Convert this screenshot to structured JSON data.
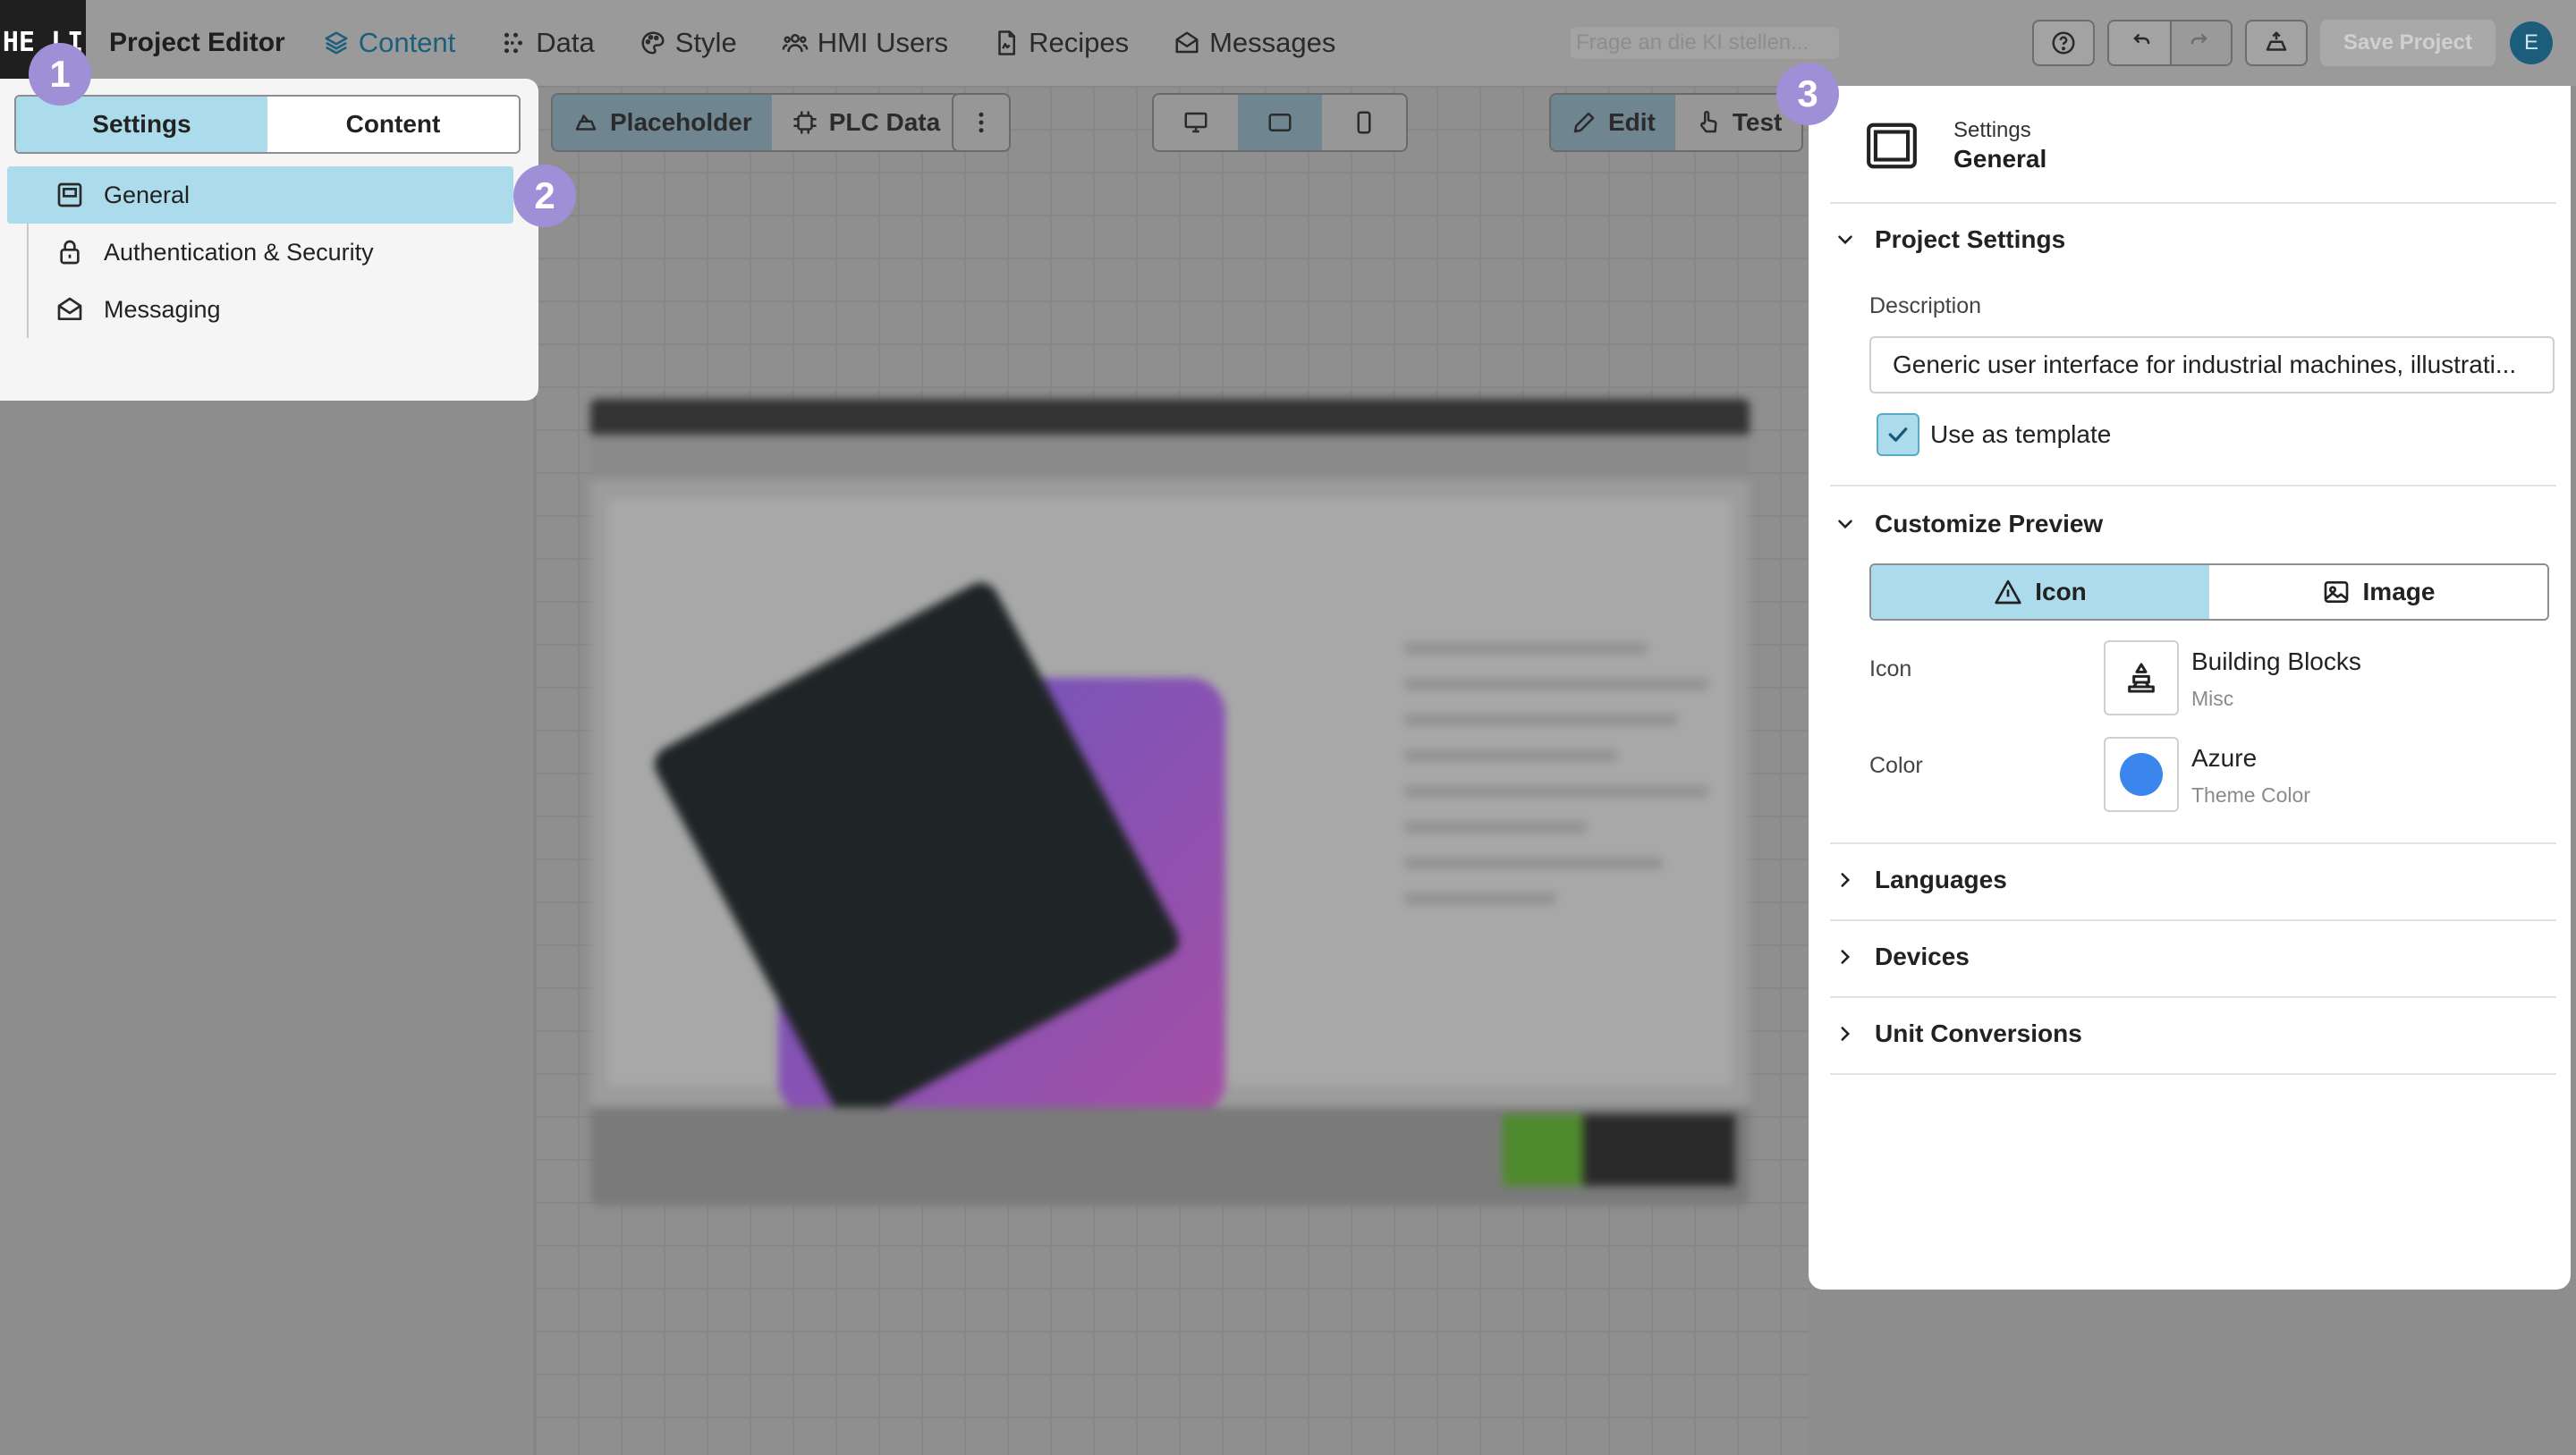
{
  "app": {
    "logo_text": "HE LI",
    "title": "Project Editor"
  },
  "nav": [
    {
      "label": "Content",
      "icon": "layers-icon",
      "active": true
    },
    {
      "label": "Data",
      "icon": "data-dots-icon"
    },
    {
      "label": "Style",
      "icon": "palette-icon"
    },
    {
      "label": "HMI Users",
      "icon": "users-icon"
    },
    {
      "label": "Recipes",
      "icon": "recipe-icon"
    },
    {
      "label": "Messages",
      "icon": "mail-icon"
    }
  ],
  "topbar": {
    "search_placeholder": "Frage an die KI stellen...",
    "help_icon": "help-icon",
    "undo_icon": "undo-icon",
    "redo_icon": "redo-icon",
    "publish_icon": "cloud-upload-icon",
    "save_label": "Save Project",
    "avatar_initial": "E"
  },
  "canvas_toolbar": {
    "placeholder_label": "Placeholder",
    "plc_label": "PLC Data",
    "edit_label": "Edit",
    "test_label": "Test",
    "devices": [
      "desktop-icon",
      "tablet-icon",
      "phone-icon"
    ],
    "active_device": "tablet-icon"
  },
  "left_panel": {
    "tabs": {
      "settings": "Settings",
      "content": "Content",
      "active": "Settings"
    },
    "items": [
      {
        "label": "General",
        "icon": "layout-icon",
        "active": true
      },
      {
        "label": "Authentication & Security",
        "icon": "lock-icon"
      },
      {
        "label": "Messaging",
        "icon": "mail-open-icon"
      }
    ]
  },
  "right_panel": {
    "header": {
      "subtitle": "Settings",
      "title": "General"
    },
    "project_settings": {
      "title": "Project Settings",
      "description_label": "Description",
      "description_value": "Generic user interface for industrial machines, illustrati...",
      "use_template_label": "Use as template",
      "use_template_checked": true
    },
    "customize_preview": {
      "title": "Customize Preview",
      "mode_icon": "Icon",
      "mode_image": "Image",
      "active_mode": "Icon",
      "icon_label": "Icon",
      "icon_name": "Building Blocks",
      "icon_category": "Misc",
      "color_label": "Color",
      "color_name": "Azure",
      "color_category": "Theme Color",
      "color_value": "#3b86ec"
    },
    "collapsed_sections": [
      "Languages",
      "Devices",
      "Unit Conversions"
    ]
  },
  "badges": [
    "1",
    "2",
    "3"
  ],
  "colors": {
    "selected": "#acdcec",
    "badge": "#9e8fd6",
    "accent": "#1b5e7d"
  }
}
